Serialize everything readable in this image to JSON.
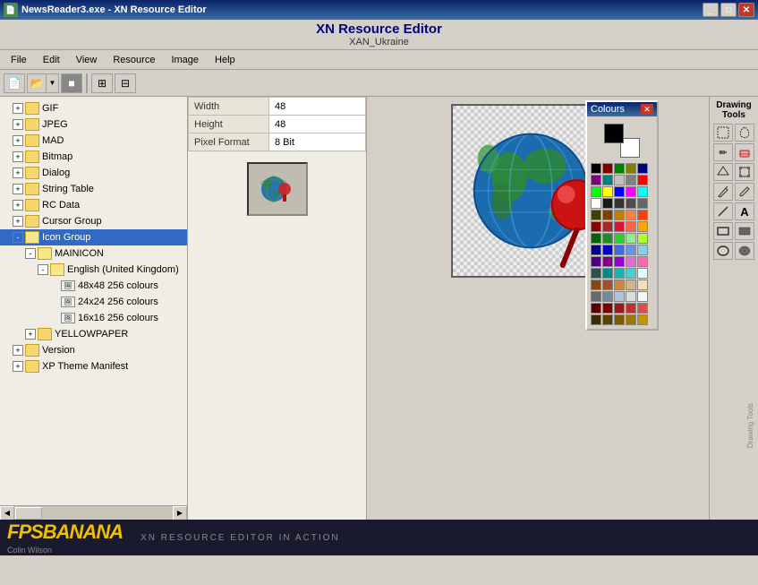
{
  "titlebar": {
    "app_name": "NewsReader3.exe - XN Resource Editor",
    "main_title": "XN Resource Editor",
    "subtitle": "XAN_Ukraine"
  },
  "menu": {
    "items": [
      "File",
      "Edit",
      "View",
      "Resource",
      "Image",
      "Help"
    ]
  },
  "properties": {
    "width_label": "Width",
    "width_value": "48",
    "height_label": "Height",
    "height_value": "48",
    "pixel_format_label": "Pixel Format",
    "pixel_format_value": "8 Bit"
  },
  "tree": {
    "items": [
      {
        "label": "GIF",
        "level": 0,
        "type": "folder",
        "expanded": false
      },
      {
        "label": "JPEG",
        "level": 0,
        "type": "folder",
        "expanded": false
      },
      {
        "label": "MAD",
        "level": 0,
        "type": "folder",
        "expanded": false
      },
      {
        "label": "Bitmap",
        "level": 0,
        "type": "folder",
        "expanded": false
      },
      {
        "label": "Dialog",
        "level": 0,
        "type": "folder",
        "expanded": false
      },
      {
        "label": "String Table",
        "level": 0,
        "type": "folder",
        "expanded": false
      },
      {
        "label": "RC Data",
        "level": 0,
        "type": "folder",
        "expanded": false
      },
      {
        "label": "Cursor Group",
        "level": 0,
        "type": "folder",
        "expanded": false
      },
      {
        "label": "Icon Group",
        "level": 0,
        "type": "folder",
        "expanded": true,
        "selected": true
      },
      {
        "label": "MAINICON",
        "level": 1,
        "type": "folder",
        "expanded": true
      },
      {
        "label": "English (United Kingdom)",
        "level": 2,
        "type": "folder",
        "expanded": true
      },
      {
        "label": "48x48 256 colours",
        "level": 3,
        "type": "file"
      },
      {
        "label": "24x24 256 colours",
        "level": 3,
        "type": "file"
      },
      {
        "label": "16x16 256 colours",
        "level": 3,
        "type": "file"
      },
      {
        "label": "YELLOWPAPER",
        "level": 1,
        "type": "folder",
        "expanded": false
      },
      {
        "label": "Version",
        "level": 0,
        "type": "folder",
        "expanded": false
      },
      {
        "label": "XP Theme Manifest",
        "level": 0,
        "type": "folder",
        "expanded": false
      }
    ]
  },
  "colours_panel": {
    "title": "Colours",
    "palette": [
      "#000000",
      "#800000",
      "#008000",
      "#808000",
      "#000080",
      "#800080",
      "#008080",
      "#c0c0c0",
      "#808080",
      "#ff0000",
      "#00ff00",
      "#ffff00",
      "#0000ff",
      "#ff00ff",
      "#00ffff",
      "#ffffff",
      "#1a1a1a",
      "#333333",
      "#4d4d4d",
      "#666666",
      "#404000",
      "#804000",
      "#c08000",
      "#ff8040",
      "#ff4000",
      "#8b0000",
      "#a52a2a",
      "#dc143c",
      "#ff6347",
      "#ffa500",
      "#006400",
      "#228b22",
      "#32cd32",
      "#90ee90",
      "#adff2f",
      "#00008b",
      "#0000cd",
      "#4169e1",
      "#6495ed",
      "#87ceeb",
      "#4b0082",
      "#800080",
      "#9400d3",
      "#da70d6",
      "#ff69b4",
      "#2f4f4f",
      "#008b8b",
      "#20b2aa",
      "#48d1cc",
      "#e0ffff",
      "#8b4513",
      "#a0522d",
      "#cd853f",
      "#d2b48c",
      "#f5deb3",
      "#696969",
      "#778899",
      "#b0c4de",
      "#dcdcdc",
      "#f5f5f5",
      "#5c0000",
      "#7b0000",
      "#9b1b1b",
      "#bf3030",
      "#d94f4f",
      "#3d2b00",
      "#5c4200",
      "#7a5900",
      "#a07800",
      "#c49600"
    ]
  },
  "drawing_tools": {
    "title": "Drawing Tools",
    "tools": [
      {
        "icon": "⬚",
        "name": "select-rect"
      },
      {
        "icon": "⌒",
        "name": "select-free"
      },
      {
        "icon": "✏️",
        "name": "pencil"
      },
      {
        "icon": "⬡",
        "name": "polygon"
      },
      {
        "icon": "◻",
        "name": "lasso"
      },
      {
        "icon": "🖌",
        "name": "brush"
      },
      {
        "icon": "✒",
        "name": "pen"
      },
      {
        "icon": "↔",
        "name": "transform"
      },
      {
        "icon": "⊘",
        "name": "eraser"
      },
      {
        "icon": "🔍",
        "name": "zoom"
      },
      {
        "icon": "/",
        "name": "line"
      },
      {
        "icon": "A",
        "name": "text"
      },
      {
        "icon": "▭",
        "name": "rect-outline"
      },
      {
        "icon": "▬",
        "name": "rect-fill"
      },
      {
        "icon": "○",
        "name": "ellipse-outline"
      },
      {
        "icon": "●",
        "name": "ellipse-fill"
      }
    ],
    "label": "Drawing Tools"
  },
  "footer": {
    "logo": "FPSBANANA",
    "tagline": "XN RESOURCE EDITOR IN ACTION",
    "author": "Colin Wilson"
  }
}
